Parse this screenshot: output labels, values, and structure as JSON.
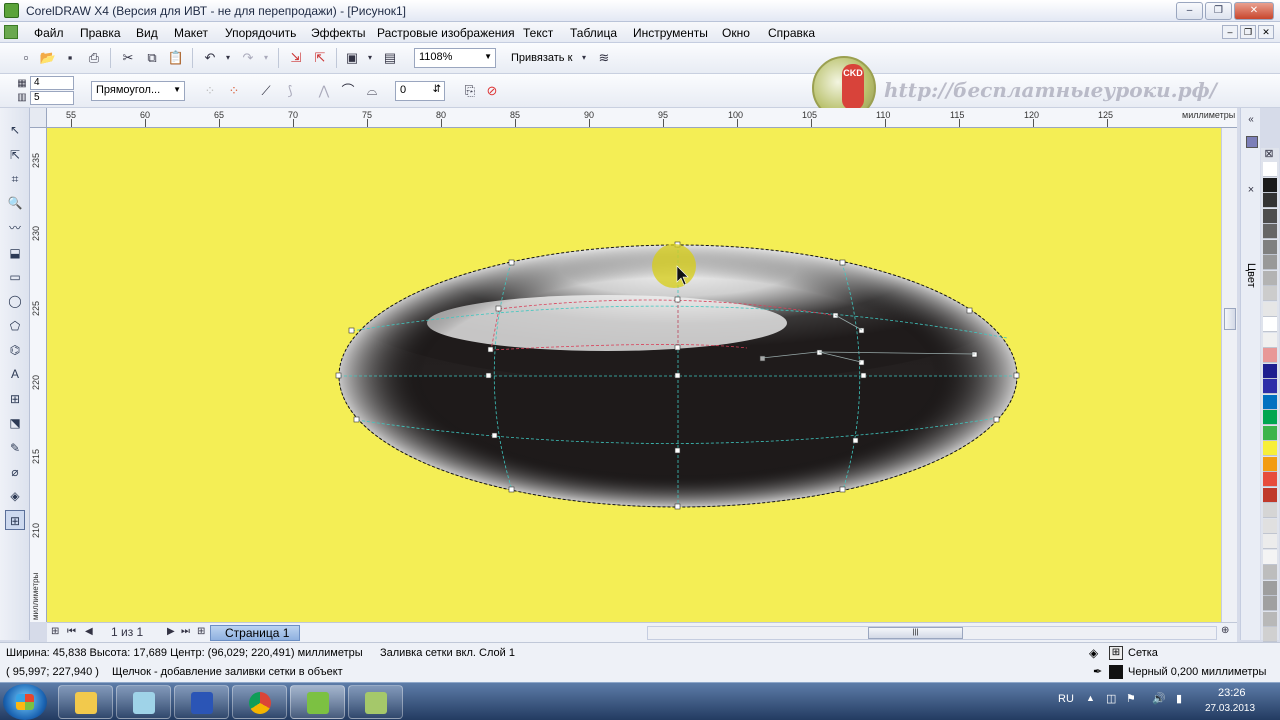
{
  "window": {
    "title": "CorelDRAW X4 (Версия для ИВТ - не для перепродажи) - [Рисунок1]",
    "controls": [
      "‒",
      "❐",
      "✕"
    ]
  },
  "menu": {
    "items": [
      "Файл",
      "Правка",
      "Вид",
      "Макет",
      "Упорядочить",
      "Эффекты",
      "Растровые изображения",
      "Текст",
      "Таблица",
      "Инструменты",
      "Окно",
      "Справка"
    ]
  },
  "toolbar": {
    "zoom": "1108%",
    "snap_label": "Привязать к",
    "rows_value": "4",
    "cols_value": "5",
    "selection_mode": "Прямоугол...",
    "smoothness_value": "0"
  },
  "watermark": {
    "logo_text": "CKD",
    "url_text": "http://бесплатныеуроки.рф/"
  },
  "ruler": {
    "h_labels": [
      "55",
      "60",
      "65",
      "70",
      "75",
      "80",
      "85",
      "90",
      "95",
      "100",
      "105",
      "110",
      "115",
      "120",
      "125"
    ],
    "h_unit": "миллиметры",
    "v_labels": [
      "235",
      "230",
      "225",
      "220",
      "215",
      "210"
    ],
    "v_unit": "миллиметры"
  },
  "docker": {
    "label": "Цвет"
  },
  "palette": {
    "colors": [
      "#ffffff",
      "#1a1a1a",
      "#333333",
      "#4d4d4d",
      "#666666",
      "#808080",
      "#999999",
      "#b3b3b3",
      "#cccccc",
      "#e6e6e6",
      "#ffffff",
      "#f0f0f0",
      "#e89898",
      "#1f1f8f",
      "#2e2ea8",
      "#0070c0",
      "#00a651",
      "#3cb44b",
      "#f7ef3a",
      "#f39c12",
      "#e74c3c",
      "#c0392b",
      "#d5d5d5",
      "#e0e0e0",
      "#ececec",
      "#f4f4f4",
      "#bdbdbd",
      "#9e9e9e",
      "#a0a0a0",
      "#b8b8b8",
      "#d0d0d0"
    ]
  },
  "pages": {
    "counter": "1 из 1",
    "tab_label": "Страница 1"
  },
  "status": {
    "dimensions": "Ширина: 45,838  Высота: 17,689  Центр: (96,029; 220,491)  миллиметры",
    "object_info": "Заливка сетки вкл. Слой 1",
    "cursor": "( 95,997; 227,940 )",
    "hint": "Щелчок - добавление заливки сетки в объект",
    "fill_label": "Сетка",
    "outline_label": "Черный  0,200 миллиметры"
  },
  "taskbar": {
    "lang": "RU",
    "time": "23:26",
    "date": "27.03.2013",
    "apps": [
      "explorer",
      "mail",
      "save",
      "chrome",
      "corel",
      "graphics"
    ]
  }
}
